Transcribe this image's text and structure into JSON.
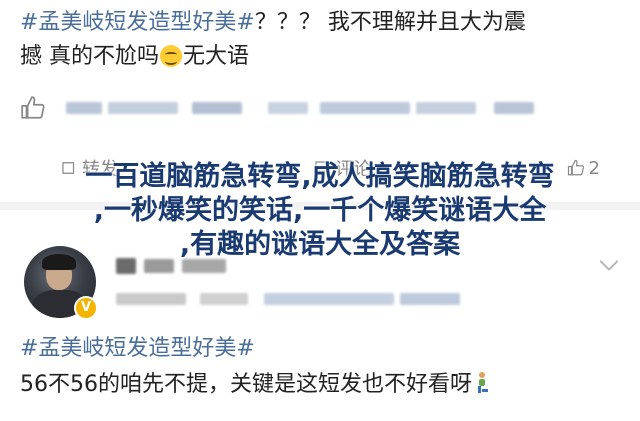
{
  "post1": {
    "hashtag": "#孟美岐短发造型好美#",
    "text_line1": "？？？ 我不理解并且大为震",
    "text_line2": "撼 真的不尬吗",
    "text_line2_tail": "无大语",
    "emoji": "grinning-sweat-emoji"
  },
  "actions": {
    "forward_label": "转发",
    "comment_label": "评论",
    "like_count": "2"
  },
  "overlay": {
    "line1": "一百道脑筋急转弯,成人搞笑脑筋急转弯",
    "line2": ",一秒爆笑的笑话,一千个爆笑谜语大全",
    "line3": ",有趣的谜语大全及答案"
  },
  "post2": {
    "hashtag": "#孟美岐短发造型好美#",
    "text": "56不56的咱先不提，关键是这短发也不好看呀",
    "verify_badge": "V",
    "trailing_icon": "person-kneeling-icon"
  },
  "colors": {
    "hashtag": "#4a6e9a",
    "overlay_text": "#1a3a72",
    "text": "#222222",
    "muted": "#888888",
    "badge": "#f4b400"
  }
}
